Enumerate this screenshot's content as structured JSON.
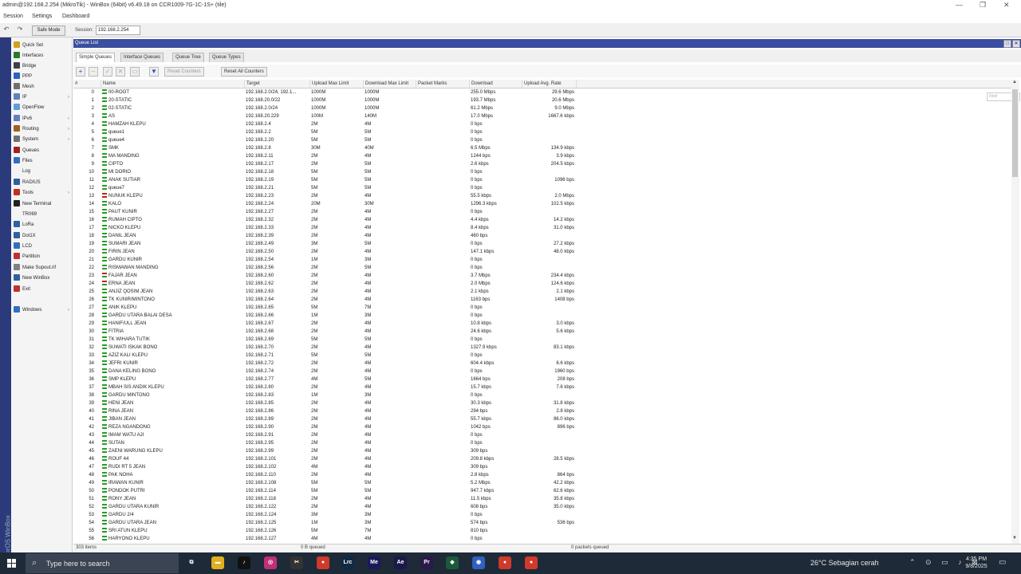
{
  "window": {
    "title": "admin@192.168.2.254 (MikroTik) - WinBox (64bit) v6.49.18 on CCR1009-7G-1C-1S+ (tile)",
    "minimize": "—",
    "restore": "❐",
    "close": "✕"
  },
  "menu": {
    "session": "Session",
    "settings": "Settings",
    "dashboard": "Dashboard"
  },
  "toolbar": {
    "undo": "↶",
    "redo": "↷",
    "safe_mode": "Safe Mode",
    "session_label": "Session:",
    "session_value": "192.168.2.254"
  },
  "brand": "RouterOS WinBox",
  "sidebar": {
    "items": [
      {
        "label": "Quick Set",
        "icon": "quick-set",
        "color": "#d0a020"
      },
      {
        "label": "Interfaces",
        "icon": "interfaces",
        "color": "#2a7a2a"
      },
      {
        "label": "Bridge",
        "icon": "bridge",
        "color": "#404040"
      },
      {
        "label": "PPP",
        "icon": "ppp",
        "color": "#3060c0"
      },
      {
        "label": "Mesh",
        "icon": "mesh",
        "color": "#707070"
      },
      {
        "label": "IP",
        "icon": "ip",
        "color": "#6080c0",
        "arrow": true
      },
      {
        "label": "OpenFlow",
        "icon": "openflow",
        "color": "#60a0d0"
      },
      {
        "label": "IPv6",
        "icon": "ipv6",
        "color": "#6080c0",
        "arrow": true
      },
      {
        "label": "Routing",
        "icon": "routing",
        "color": "#a06020",
        "arrow": true
      },
      {
        "label": "System",
        "icon": "system",
        "color": "#707070",
        "arrow": true
      },
      {
        "label": "Queues",
        "icon": "queues",
        "color": "#a02020"
      },
      {
        "label": "Files",
        "icon": "files",
        "color": "#3070c0"
      },
      {
        "label": "Log",
        "icon": "log",
        "color": "#f4f4f4"
      },
      {
        "label": "RADIUS",
        "icon": "radius",
        "color": "#3060a0"
      },
      {
        "label": "Tools",
        "icon": "tools",
        "color": "#c03020",
        "arrow": true
      },
      {
        "label": "New Terminal",
        "icon": "terminal",
        "color": "#202020"
      },
      {
        "label": "TR069",
        "icon": "tr069",
        "color": "#f4f4f4"
      },
      {
        "label": "LoRa",
        "icon": "lora",
        "color": "#3060a0"
      },
      {
        "label": "Dot1X",
        "icon": "dot1x",
        "color": "#3060a0"
      },
      {
        "label": "LCD",
        "icon": "lcd",
        "color": "#3070c0"
      },
      {
        "label": "Partition",
        "icon": "partition",
        "color": "#c03030"
      },
      {
        "label": "Make Supout.rif",
        "icon": "supout",
        "color": "#808080"
      },
      {
        "label": "New WinBox",
        "icon": "winbox",
        "color": "#3060a0"
      },
      {
        "label": "Exit",
        "icon": "exit",
        "color": "#c03030"
      },
      {
        "label": "Windows",
        "icon": "windows",
        "color": "#3070c0",
        "arrow": true
      }
    ]
  },
  "queue_window": {
    "title": "Queue List",
    "tabs": [
      "Simple Queues",
      "Interface Queues",
      "Queue Tree",
      "Queue Types"
    ],
    "reset_counters": "Reset Counters",
    "reset_all_counters": "Reset All Counters",
    "find_placeholder": "Find",
    "columns": [
      "#",
      "Name",
      "Target",
      "Upload Max Limit",
      "Download Max Limit",
      "Packet Marks",
      "Download",
      "Upload Avg. Rate"
    ],
    "rows": [
      [
        "0",
        "00-ROOT",
        "192.168.2.0/24, 192.1...",
        "1000M",
        "1000M",
        "",
        "255.0 Mbps",
        "29.6 Mbps",
        "g"
      ],
      [
        "1",
        "20-STATIC",
        "192.168.20.0/22",
        "1000M",
        "1000M",
        "",
        "193.7 Mbps",
        "20.6 Mbps",
        "g"
      ],
      [
        "2",
        "02-STATIC",
        "192.168.2.0/24",
        "1000M",
        "1000M",
        "",
        "61.2 Mbps",
        "9.0 Mbps",
        "g"
      ],
      [
        "3",
        "AS",
        "192.168.20.229",
        "100M",
        "140M",
        "",
        "17.0 Mbps",
        "1667.6 kbps",
        "g"
      ],
      [
        "4",
        "HAMZAH KLEPU",
        "192.168.2.4",
        "2M",
        "4M",
        "",
        "0 bps",
        "",
        "g"
      ],
      [
        "5",
        "queue1",
        "192.168.2.2",
        "5M",
        "5M",
        "",
        "0 bps",
        "",
        "g"
      ],
      [
        "6",
        "queue4",
        "192.168.2.20",
        "5M",
        "5M",
        "",
        "0 bps",
        "",
        "g"
      ],
      [
        "7",
        "SMK",
        "192.168.2.8",
        "30M",
        "40M",
        "",
        "6.5 Mbps",
        "134.9 kbps",
        "g"
      ],
      [
        "8",
        "MA MANDING",
        "192.168.2.11",
        "2M",
        "4M",
        "",
        "1244 bps",
        "3.9 kbps",
        "g"
      ],
      [
        "9",
        "CIPTO",
        "192.168.2.17",
        "2M",
        "5M",
        "",
        "2.6 kbps",
        "204.5 kbps",
        "g"
      ],
      [
        "10",
        "MI DORIO",
        "192.168.2.18",
        "5M",
        "5M",
        "",
        "0 bps",
        "",
        "g"
      ],
      [
        "11",
        "ANAK SUTIAR",
        "192.168.2.19",
        "5M",
        "5M",
        "",
        "0 bps",
        "1096 bps",
        "g"
      ],
      [
        "12",
        "queue7",
        "192.168.2.21",
        "5M",
        "5M",
        "",
        "0 bps",
        "",
        "g"
      ],
      [
        "13",
        "NUNUK KLEPU",
        "192.168.2.23",
        "2M",
        "4M",
        "",
        "55.5 kbps",
        "2.0 Mbps",
        "r"
      ],
      [
        "14",
        "KALO",
        "192.168.2.24",
        "20M",
        "30M",
        "",
        "1296.3 kbps",
        "102.5 kbps",
        "g"
      ],
      [
        "15",
        "PAUT KUNIR",
        "192.168.2.27",
        "2M",
        "4M",
        "",
        "0 bps",
        "",
        "g"
      ],
      [
        "16",
        "RUMAH CIPTO",
        "192.168.2.32",
        "2M",
        "4M",
        "",
        "4.4 kbps",
        "14.2 kbps",
        "g"
      ],
      [
        "17",
        "NICKO KLEPU",
        "192.168.2.33",
        "2M",
        "4M",
        "",
        "8.4 kbps",
        "31.0 kbps",
        "g"
      ],
      [
        "18",
        "DANIL JEAN",
        "192.168.2.39",
        "2M",
        "4M",
        "",
        "460 bps",
        "",
        "g"
      ],
      [
        "19",
        "SUMARI JEAN",
        "192.168.2.49",
        "3M",
        "5M",
        "",
        "0 bps",
        "27.2 kbps",
        "g"
      ],
      [
        "20",
        "FIRIN JEAN",
        "192.168.2.50",
        "2M",
        "4M",
        "",
        "147.1 kbps",
        "48.0 kbps",
        "g"
      ],
      [
        "21",
        "GARDU KUNIR",
        "192.168.2.54",
        "1M",
        "3M",
        "",
        "0 bps",
        "",
        "g"
      ],
      [
        "22",
        "RISMAWAN MANDING",
        "192.168.2.56",
        "2M",
        "5M",
        "",
        "0 bps",
        "",
        "g"
      ],
      [
        "23",
        "FAJAR JEAN",
        "192.168.2.60",
        "2M",
        "4M",
        "",
        "3.7 Mbps",
        "234.4 kbps",
        "h"
      ],
      [
        "24",
        "ERNA JEAN",
        "192.168.2.62",
        "2M",
        "4M",
        "",
        "2.0 Mbps",
        "124.6 kbps",
        "h"
      ],
      [
        "25",
        "ANJIZ QOSIM JEAN",
        "192.168.2.63",
        "2M",
        "4M",
        "",
        "2.1 kbps",
        "2.1 kbps",
        "g"
      ],
      [
        "26",
        "TK KUNIR/MINTONO",
        "192.168.2.64",
        "2M",
        "4M",
        "",
        "1163 bps",
        "1408 bps",
        "g"
      ],
      [
        "27",
        "ANIK KLEPU",
        "192.168.2.65",
        "5M",
        "7M",
        "",
        "0 bps",
        "",
        "g"
      ],
      [
        "28",
        "GARDU UTARA BALAI DESA",
        "192.168.2.66",
        "1M",
        "3M",
        "",
        "0 bps",
        "",
        "g"
      ],
      [
        "29",
        "HANIF/ULL JEAN",
        "192.168.2.67",
        "2M",
        "4M",
        "",
        "10.8 kbps",
        "3.0 kbps",
        "g"
      ],
      [
        "30",
        "FITRIA",
        "192.168.2.68",
        "2M",
        "4M",
        "",
        "24.6 kbps",
        "5.6 kbps",
        "g"
      ],
      [
        "31",
        "TK WIHARA TUTIK",
        "192.168.2.69",
        "5M",
        "5M",
        "",
        "0 bps",
        "",
        "g"
      ],
      [
        "32",
        "SUWATI ISKAK BONO",
        "192.168.2.70",
        "2M",
        "4M",
        "",
        "1327.9 kbps",
        "83.1 kbps",
        "g"
      ],
      [
        "33",
        "AZIZ KALI KLEPU",
        "192.168.2.71",
        "5M",
        "5M",
        "",
        "0 bps",
        "",
        "g"
      ],
      [
        "34",
        "JEFRI KUNIR",
        "192.168.2.72",
        "2M",
        "4M",
        "",
        "604.4 kbps",
        "6.6 kbps",
        "g"
      ],
      [
        "35",
        "DANA KELING BONO",
        "192.168.2.74",
        "2M",
        "4M",
        "",
        "0 bps",
        "1960 bps",
        "g"
      ],
      [
        "36",
        "SMP KLEPU",
        "192.168.2.77",
        "4M",
        "5M",
        "",
        "1664 bps",
        "208 bps",
        "g"
      ],
      [
        "37",
        "MBAH SIS ANDIK KLEPU",
        "192.168.2.80",
        "2M",
        "4M",
        "",
        "15.7 kbps",
        "7.6 kbps",
        "g"
      ],
      [
        "38",
        "GARDU MINTONO",
        "192.168.2.83",
        "1M",
        "3M",
        "",
        "0 bps",
        "",
        "g"
      ],
      [
        "39",
        "HENI JEAN",
        "192.168.2.85",
        "2M",
        "4M",
        "",
        "30.3 kbps",
        "31.8 kbps",
        "g"
      ],
      [
        "40",
        "RINA JEAN",
        "192.168.2.86",
        "2M",
        "4M",
        "",
        "294 bps",
        "2.8 kbps",
        "g"
      ],
      [
        "41",
        "JIBAN JEAN",
        "192.168.2.89",
        "2M",
        "4M",
        "",
        "55.7 kbps",
        "86.0 kbps",
        "g"
      ],
      [
        "42",
        "REZA NGANDONG",
        "192.168.2.90",
        "2M",
        "4M",
        "",
        "1042 bps",
        "896 bps",
        "g"
      ],
      [
        "43",
        "IMAM WATU AJI",
        "192.168.2.91",
        "2M",
        "4M",
        "",
        "0 bps",
        "",
        "g"
      ],
      [
        "44",
        "SUTAN",
        "192.168.2.95",
        "2M",
        "4M",
        "",
        "0 bps",
        "",
        "g"
      ],
      [
        "45",
        "ZAENI WARUNG KLEPU",
        "192.168.2.99",
        "2M",
        "4M",
        "",
        "309 bps",
        "",
        "g"
      ],
      [
        "46",
        "ROUF 44",
        "192.168.2.101",
        "2M",
        "4M",
        "",
        "209.8 kbps",
        "28.5 kbps",
        "g"
      ],
      [
        "47",
        "RUDI RT 5 JEAN",
        "192.168.2.102",
        "4M",
        "4M",
        "",
        "309 bps",
        "",
        "g"
      ],
      [
        "48",
        "PAK NOHA",
        "192.168.2.110",
        "2M",
        "4M",
        "",
        "2.8 kbps",
        "864 bps",
        "g"
      ],
      [
        "49",
        "IRAWAN KUNIR",
        "192.168.2.108",
        "5M",
        "5M",
        "",
        "5.2 Mbps",
        "42.2 kbps",
        "g"
      ],
      [
        "50",
        "PONDOK PUTRI",
        "192.168.2.114",
        "5M",
        "5M",
        "",
        "947.7 kbps",
        "62.6 kbps",
        "g"
      ],
      [
        "51",
        "RONY JEAN",
        "192.168.2.118",
        "2M",
        "4M",
        "",
        "11.5 kbps",
        "35.8 kbps",
        "g"
      ],
      [
        "52",
        "GARDU UTARA KUNIR",
        "192.168.2.122",
        "2M",
        "4M",
        "",
        "608 bps",
        "35.0 kbps",
        "g"
      ],
      [
        "53",
        "GARDU 2/4",
        "192.168.2.124",
        "3M",
        "3M",
        "",
        "0 bps",
        "",
        "g"
      ],
      [
        "54",
        "GARDU UTARA JEAN",
        "192.168.2.125",
        "1M",
        "3M",
        "",
        "574 bps",
        "536 bps",
        "g"
      ],
      [
        "55",
        "SRI ATUN KLEPU",
        "192.168.2.126",
        "5M",
        "7M",
        "",
        "810 bps",
        "",
        "g"
      ],
      [
        "56",
        "HARYONO KLEPU",
        "192.168.2.127",
        "4M",
        "4M",
        "",
        "0 bps",
        "",
        "g"
      ]
    ],
    "status": {
      "items": "303 items",
      "queued": "0 B queued",
      "packets_queued": "0 packets queued"
    }
  },
  "taskbar": {
    "search_placeholder": "Type here to search",
    "weather": "26°C  Sebagian cerah",
    "time": "4:35 PM",
    "date": "9/8/2025",
    "apps": [
      {
        "name": "task-view",
        "label": "⧉",
        "color": "#1e2a38"
      },
      {
        "name": "file-explorer",
        "label": "▬",
        "color": "#e0b020"
      },
      {
        "name": "tiktok",
        "label": "♪",
        "color": "#111111"
      },
      {
        "name": "instagram",
        "label": "◎",
        "color": "#c0307a"
      },
      {
        "name": "capcut",
        "label": "✂",
        "color": "#333333"
      },
      {
        "name": "chrome",
        "label": "●",
        "color": "#d03a2a"
      },
      {
        "name": "lightroom-classic",
        "label": "Lrc",
        "color": "#0e2a44"
      },
      {
        "name": "media-encoder",
        "label": "Me",
        "color": "#1a1a5a"
      },
      {
        "name": "after-effects",
        "label": "Ae",
        "color": "#1a1a4a"
      },
      {
        "name": "premiere-pro",
        "label": "Pr",
        "color": "#2a1a4a"
      },
      {
        "name": "app-green",
        "label": "◆",
        "color": "#1a5a3a"
      },
      {
        "name": "winbox",
        "label": "◉",
        "color": "#3060c0"
      },
      {
        "name": "chrome-2",
        "label": "●",
        "color": "#d03a2a"
      },
      {
        "name": "chrome-3",
        "label": "●",
        "color": "#d03a2a"
      }
    ]
  },
  "colors": {
    "title_bar": "#3a4fa0",
    "brand_strip": "#2b3a7a",
    "taskbar": "#1e2a38",
    "queue_ok": "#2a9a2a",
    "queue_limit": "#c02020"
  }
}
